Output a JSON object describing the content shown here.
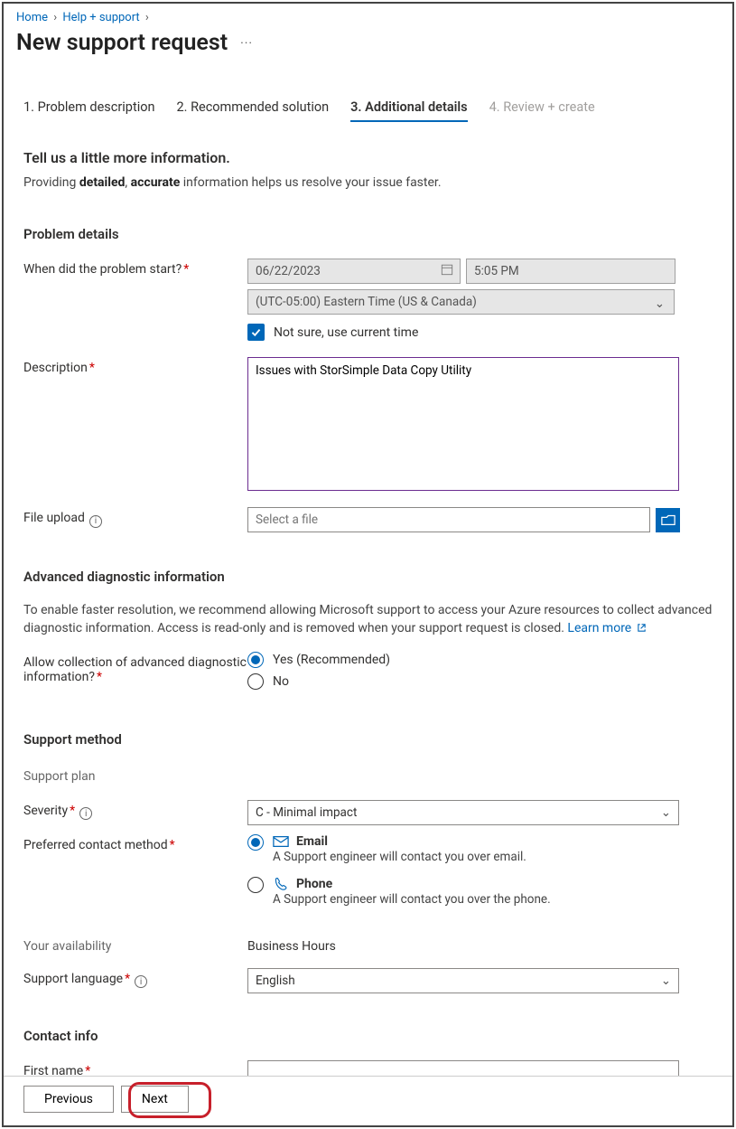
{
  "breadcrumb": {
    "home": "Home",
    "help": "Help + support"
  },
  "pageTitle": "New support request",
  "tabs": [
    "1. Problem description",
    "2. Recommended solution",
    "3. Additional details",
    "4. Review + create"
  ],
  "intro": {
    "heading": "Tell us a little more information.",
    "text1": "Providing ",
    "b1": "detailed",
    "text2": ", ",
    "b2": "accurate",
    "text3": " information helps us resolve your issue faster."
  },
  "problem": {
    "heading": "Problem details",
    "whenLabel": "When did the problem start?",
    "date": "06/22/2023",
    "time": "5:05 PM",
    "tz": "(UTC-05:00) Eastern Time (US & Canada)",
    "chkLabel": "Not sure, use current time",
    "descLabel": "Description",
    "descValue": "Issues with StorSimple Data Copy Utility",
    "fileLabel": "File upload",
    "filePlaceholder": "Select a file"
  },
  "diag": {
    "heading": "Advanced diagnostic information",
    "paraA": "To enable faster resolution, we recommend allowing Microsoft support to access your Azure resources to collect advanced diagnostic information. Access is read-only and is removed when your support request is closed. ",
    "learn": "Learn more",
    "qLabel": "Allow collection of advanced diagnostic information?",
    "yes": "Yes (Recommended)",
    "no": "No"
  },
  "support": {
    "heading": "Support method",
    "planLabel": "Support plan",
    "sevLabel": "Severity",
    "sevValue": "C - Minimal impact",
    "contactLabel": "Preferred contact method",
    "emailTitle": "Email",
    "emailSub": "A Support engineer will contact you over email.",
    "phoneTitle": "Phone",
    "phoneSub": "A Support engineer will contact you over the phone.",
    "availLabel": "Your availability",
    "availValue": "Business Hours",
    "langLabel": "Support language",
    "langValue": "English"
  },
  "contact": {
    "heading": "Contact info",
    "firstLabel": "First name"
  },
  "footer": {
    "prev": "Previous",
    "next": "Next"
  }
}
